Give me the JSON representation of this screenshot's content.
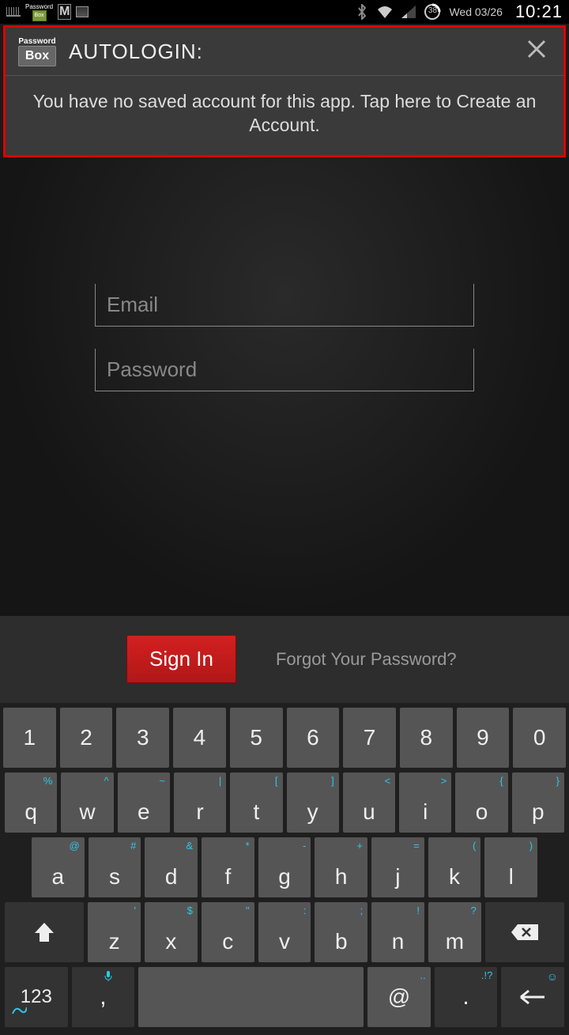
{
  "status": {
    "date": "Wed 03/26",
    "time": "10:21",
    "battery": "38"
  },
  "autologin": {
    "logo_top": "Password",
    "logo_box": "Box",
    "title": "AUTOLOGIN:",
    "message": "You have no saved account for this app. Tap here to Create an Account."
  },
  "login": {
    "email_placeholder": "Email",
    "password_placeholder": "Password",
    "signin": "Sign In",
    "forgot": "Forgot Your Password?"
  },
  "keyboard": {
    "row1": [
      "1",
      "2",
      "3",
      "4",
      "5",
      "6",
      "7",
      "8",
      "9",
      "0"
    ],
    "row2": [
      {
        "k": "q",
        "s": "%"
      },
      {
        "k": "w",
        "s": "^"
      },
      {
        "k": "e",
        "s": "~"
      },
      {
        "k": "r",
        "s": "|"
      },
      {
        "k": "t",
        "s": "["
      },
      {
        "k": "y",
        "s": "]"
      },
      {
        "k": "u",
        "s": "<"
      },
      {
        "k": "i",
        "s": ">"
      },
      {
        "k": "o",
        "s": "{"
      },
      {
        "k": "p",
        "s": "}"
      }
    ],
    "row3": [
      {
        "k": "a",
        "s": "@"
      },
      {
        "k": "s",
        "s": "#"
      },
      {
        "k": "d",
        "s": "&"
      },
      {
        "k": "f",
        "s": "*"
      },
      {
        "k": "g",
        "s": "-"
      },
      {
        "k": "h",
        "s": "+"
      },
      {
        "k": "j",
        "s": "="
      },
      {
        "k": "k",
        "s": "("
      },
      {
        "k": "l",
        "s": ")"
      }
    ],
    "row4": [
      {
        "k": "z",
        "s": "'"
      },
      {
        "k": "x",
        "s": "$"
      },
      {
        "k": "c",
        "s": "\""
      },
      {
        "k": "v",
        "s": ":"
      },
      {
        "k": "b",
        "s": ";"
      },
      {
        "k": "n",
        "s": "!"
      },
      {
        "k": "m",
        "s": "?"
      }
    ],
    "row5": {
      "numbers": "123",
      "comma": ",",
      "at": "@",
      "period": ".",
      "period_sup": ".!?",
      "space": ""
    }
  }
}
